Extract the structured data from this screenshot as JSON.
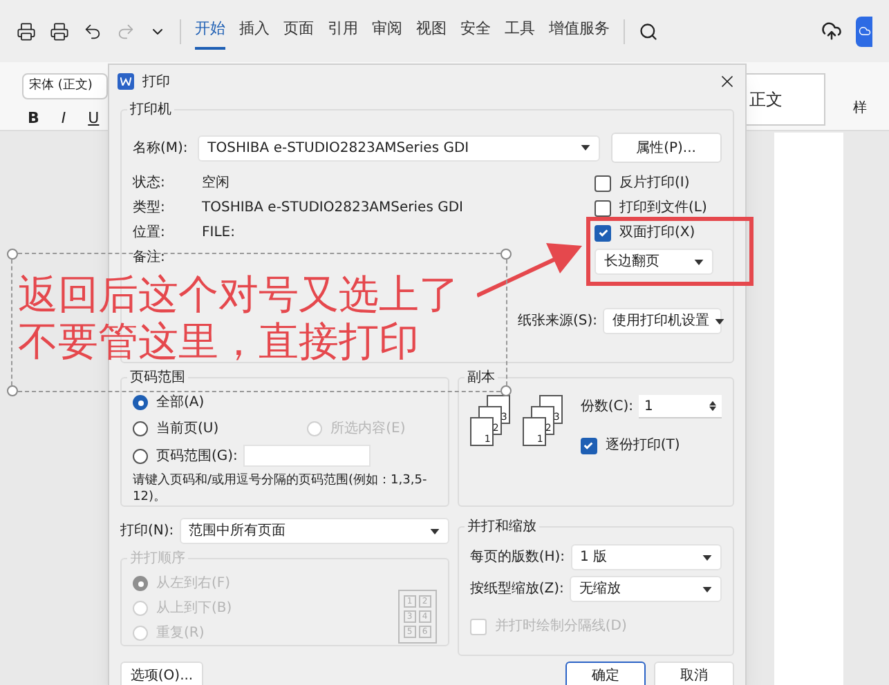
{
  "toolbar": {
    "tabs": [
      {
        "label": "开始",
        "selected": true
      },
      {
        "label": "插入",
        "selected": false
      },
      {
        "label": "页面",
        "selected": false
      },
      {
        "label": "引用",
        "selected": false
      },
      {
        "label": "审阅",
        "selected": false
      },
      {
        "label": "视图",
        "selected": false
      },
      {
        "label": "安全",
        "selected": false
      },
      {
        "label": "工具",
        "selected": false
      },
      {
        "label": "增值服务",
        "selected": false
      }
    ]
  },
  "ribbon": {
    "font_name": "宋体 (正文)",
    "format_buttons": [
      "B",
      "I",
      "U"
    ],
    "style": "正文",
    "style_label": "样"
  },
  "dialog": {
    "title": "打印",
    "printer": {
      "title": "打印机",
      "name_label": "名称(M):",
      "name_value": "TOSHIBA e-STUDIO2823AMSeries GDI",
      "properties_button": "属性(P)...",
      "info": [
        {
          "label": "状态:",
          "value": "空闲"
        },
        {
          "label": "类型:",
          "value": "TOSHIBA e-STUDIO2823AMSeries GDI"
        },
        {
          "label": "位置:",
          "value": "FILE:"
        },
        {
          "label": "备注:"
        }
      ],
      "options": [
        {
          "label": "反片打印(I)",
          "checked": false
        },
        {
          "label": "打印到文件(L)",
          "checked": false
        },
        {
          "label": "双面打印(X)",
          "checked": true
        }
      ],
      "duplex_value": "长边翻页",
      "paper_source_label": "纸张来源(S):",
      "paper_source_value": "使用打印机设置"
    },
    "page_range": {
      "title": "页码范围",
      "radios": [
        {
          "label": "全部(A)",
          "selected": true,
          "disabled": false
        },
        {
          "label": "当前页(U)",
          "selected": false,
          "disabled": false
        },
        {
          "label": "所选内容(E)",
          "selected": false,
          "disabled": true
        },
        {
          "label": "页码范围(G):",
          "selected": false,
          "disabled": false
        }
      ],
      "hint": "请键入页码和/或用逗号分隔的页码范围(例如：1,3,5-12)。"
    },
    "print_label": "打印(N):",
    "print_value": "范围中所有页面",
    "order": {
      "title": "并打顺序",
      "disabled": true,
      "radios": [
        {
          "label": "从左到右(F)",
          "selected": true
        },
        {
          "label": "从上到下(B)",
          "selected": false
        },
        {
          "label": "重复(R)",
          "selected": false
        }
      ],
      "grid": [
        "1",
        "2",
        "3",
        "4",
        "5",
        "6"
      ]
    },
    "copies": {
      "title": "副本",
      "stacks": [
        [
          "1",
          "2",
          "3"
        ],
        [
          "1",
          "2",
          "3"
        ]
      ],
      "count_label": "份数(C):",
      "count_value": "1",
      "collate": {
        "label": "逐份打印(T)",
        "checked": true
      }
    },
    "zoom": {
      "title": "并打和缩放",
      "pages_label": "每页的版数(H):",
      "pages_value": "1 版",
      "scale_label": "按纸型缩放(Z):",
      "scale_value": "无缩放",
      "borders": {
        "label": "并打时绘制分隔线(D)",
        "checked": false,
        "disabled": true
      }
    },
    "buttons": {
      "options": "选项(O)...",
      "ok": "确定",
      "cancel": "取消"
    }
  },
  "annotation": {
    "lines": [
      "返回后这个对号又选上了",
      "不要管这里，直接打印"
    ]
  }
}
